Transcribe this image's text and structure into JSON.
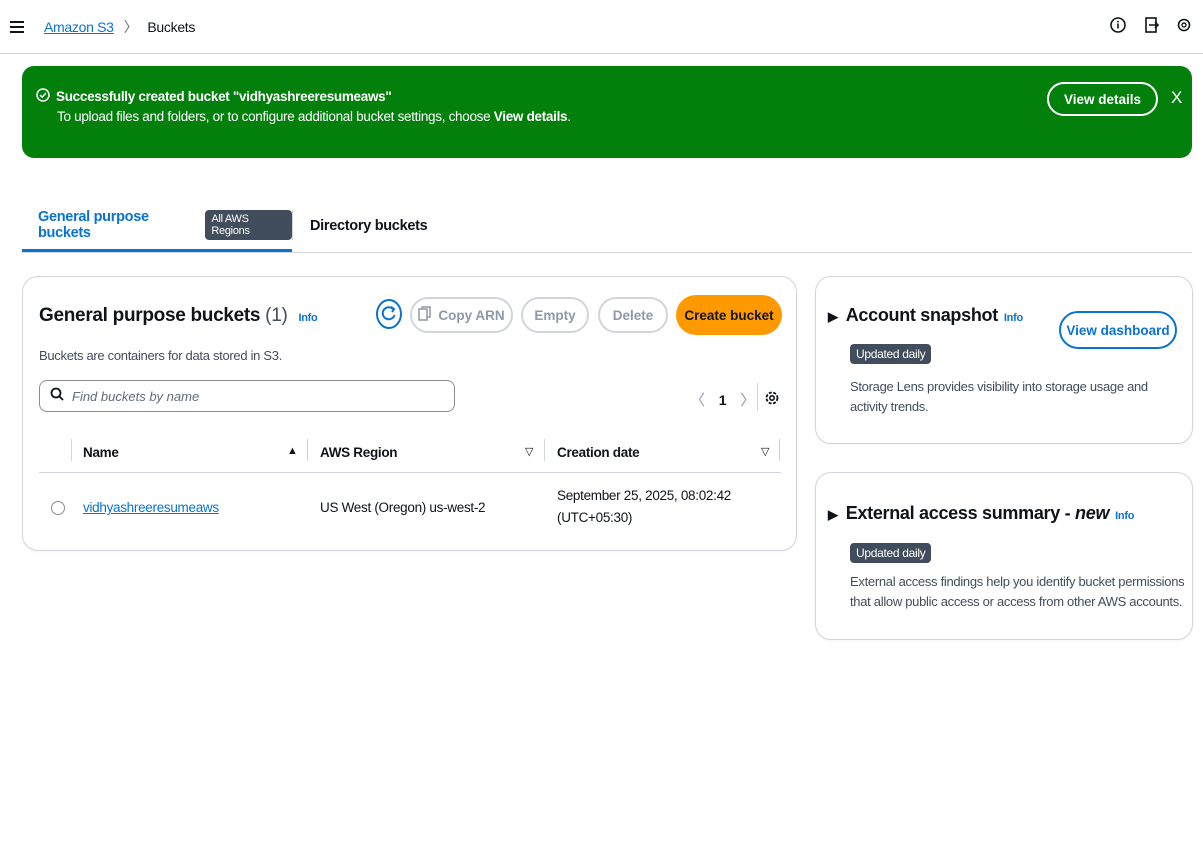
{
  "header": {
    "breadcrumb_link": "Amazon S3",
    "breadcrumb_current": "Buckets"
  },
  "flash": {
    "title": "Successfully created bucket \"vidhyashreeresumeaws\"",
    "desc_prefix": "To upload files and folders, or to configure additional bucket settings, choose ",
    "desc_bold": "View details",
    "desc_suffix": ".",
    "button": "View details",
    "close": "X",
    "color": "#037f0c"
  },
  "tabs": [
    {
      "label": "General purpose buckets",
      "badge": "All AWS Regions",
      "active": true
    },
    {
      "label": "Directory buckets",
      "active": false
    }
  ],
  "main": {
    "title": "General purpose buckets",
    "count": "(1)",
    "info": "Info",
    "description": "Buckets are containers for data stored in S3.",
    "buttons": {
      "copy_arn": "Copy ARN",
      "empty": "Empty",
      "delete": "Delete",
      "create": "Create bucket"
    },
    "search_placeholder": "Find buckets by name",
    "page": "1",
    "columns": [
      "Name",
      "AWS Region",
      "Creation date"
    ],
    "rows": [
      {
        "name": "vidhyashreeresumeaws",
        "region": "US West (Oregon) us-west-2",
        "date_line1": "September 25, 2025, 08:02:42",
        "date_line2": "(UTC+05:30)"
      }
    ]
  },
  "snapshot": {
    "title": "Account snapshot",
    "info": "Info",
    "badge": "Updated daily",
    "button": "View dashboard",
    "text": "Storage Lens provides visibility into storage usage and activity trends."
  },
  "external": {
    "title": "External access summary - ",
    "title_new": "new",
    "info": "Info",
    "badge": "Updated daily",
    "text": "External access findings help you identify bucket permissions that allow public access or access from other AWS accounts."
  },
  "colors": {
    "link": "#0972d3",
    "primary": "#ff9900",
    "success": "#037f0c"
  }
}
